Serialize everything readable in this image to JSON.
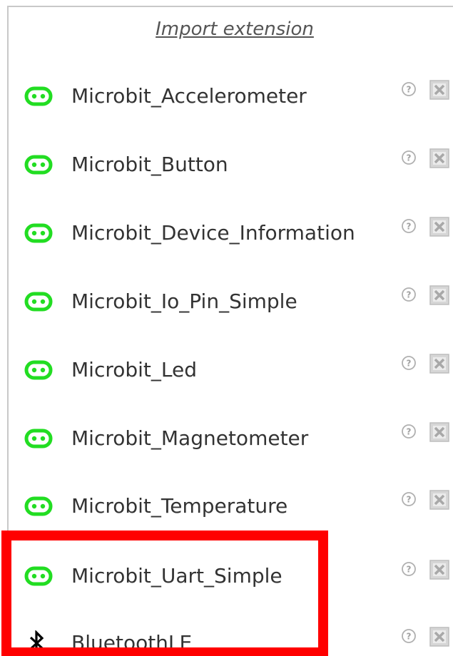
{
  "header": {
    "import_link": "Import extension"
  },
  "extensions": [
    {
      "label": "Microbit_Accelerometer",
      "icon": "microbit-icon"
    },
    {
      "label": "Microbit_Button",
      "icon": "microbit-icon"
    },
    {
      "label": "Microbit_Device_Information",
      "icon": "microbit-icon"
    },
    {
      "label": "Microbit_Io_Pin_Simple",
      "icon": "microbit-icon"
    },
    {
      "label": "Microbit_Led",
      "icon": "microbit-icon"
    },
    {
      "label": "Microbit_Magnetometer",
      "icon": "microbit-icon"
    },
    {
      "label": "Microbit_Temperature",
      "icon": "microbit-icon"
    },
    {
      "label": "Microbit_Uart_Simple",
      "icon": "microbit-icon"
    },
    {
      "label": "BluetoothLE",
      "icon": "bluetooth-icon"
    }
  ],
  "colors": {
    "microbit_green": "#22dd22",
    "highlight": "#ff0000",
    "text": "#333333",
    "icon_grey": "#c8c8c8"
  }
}
